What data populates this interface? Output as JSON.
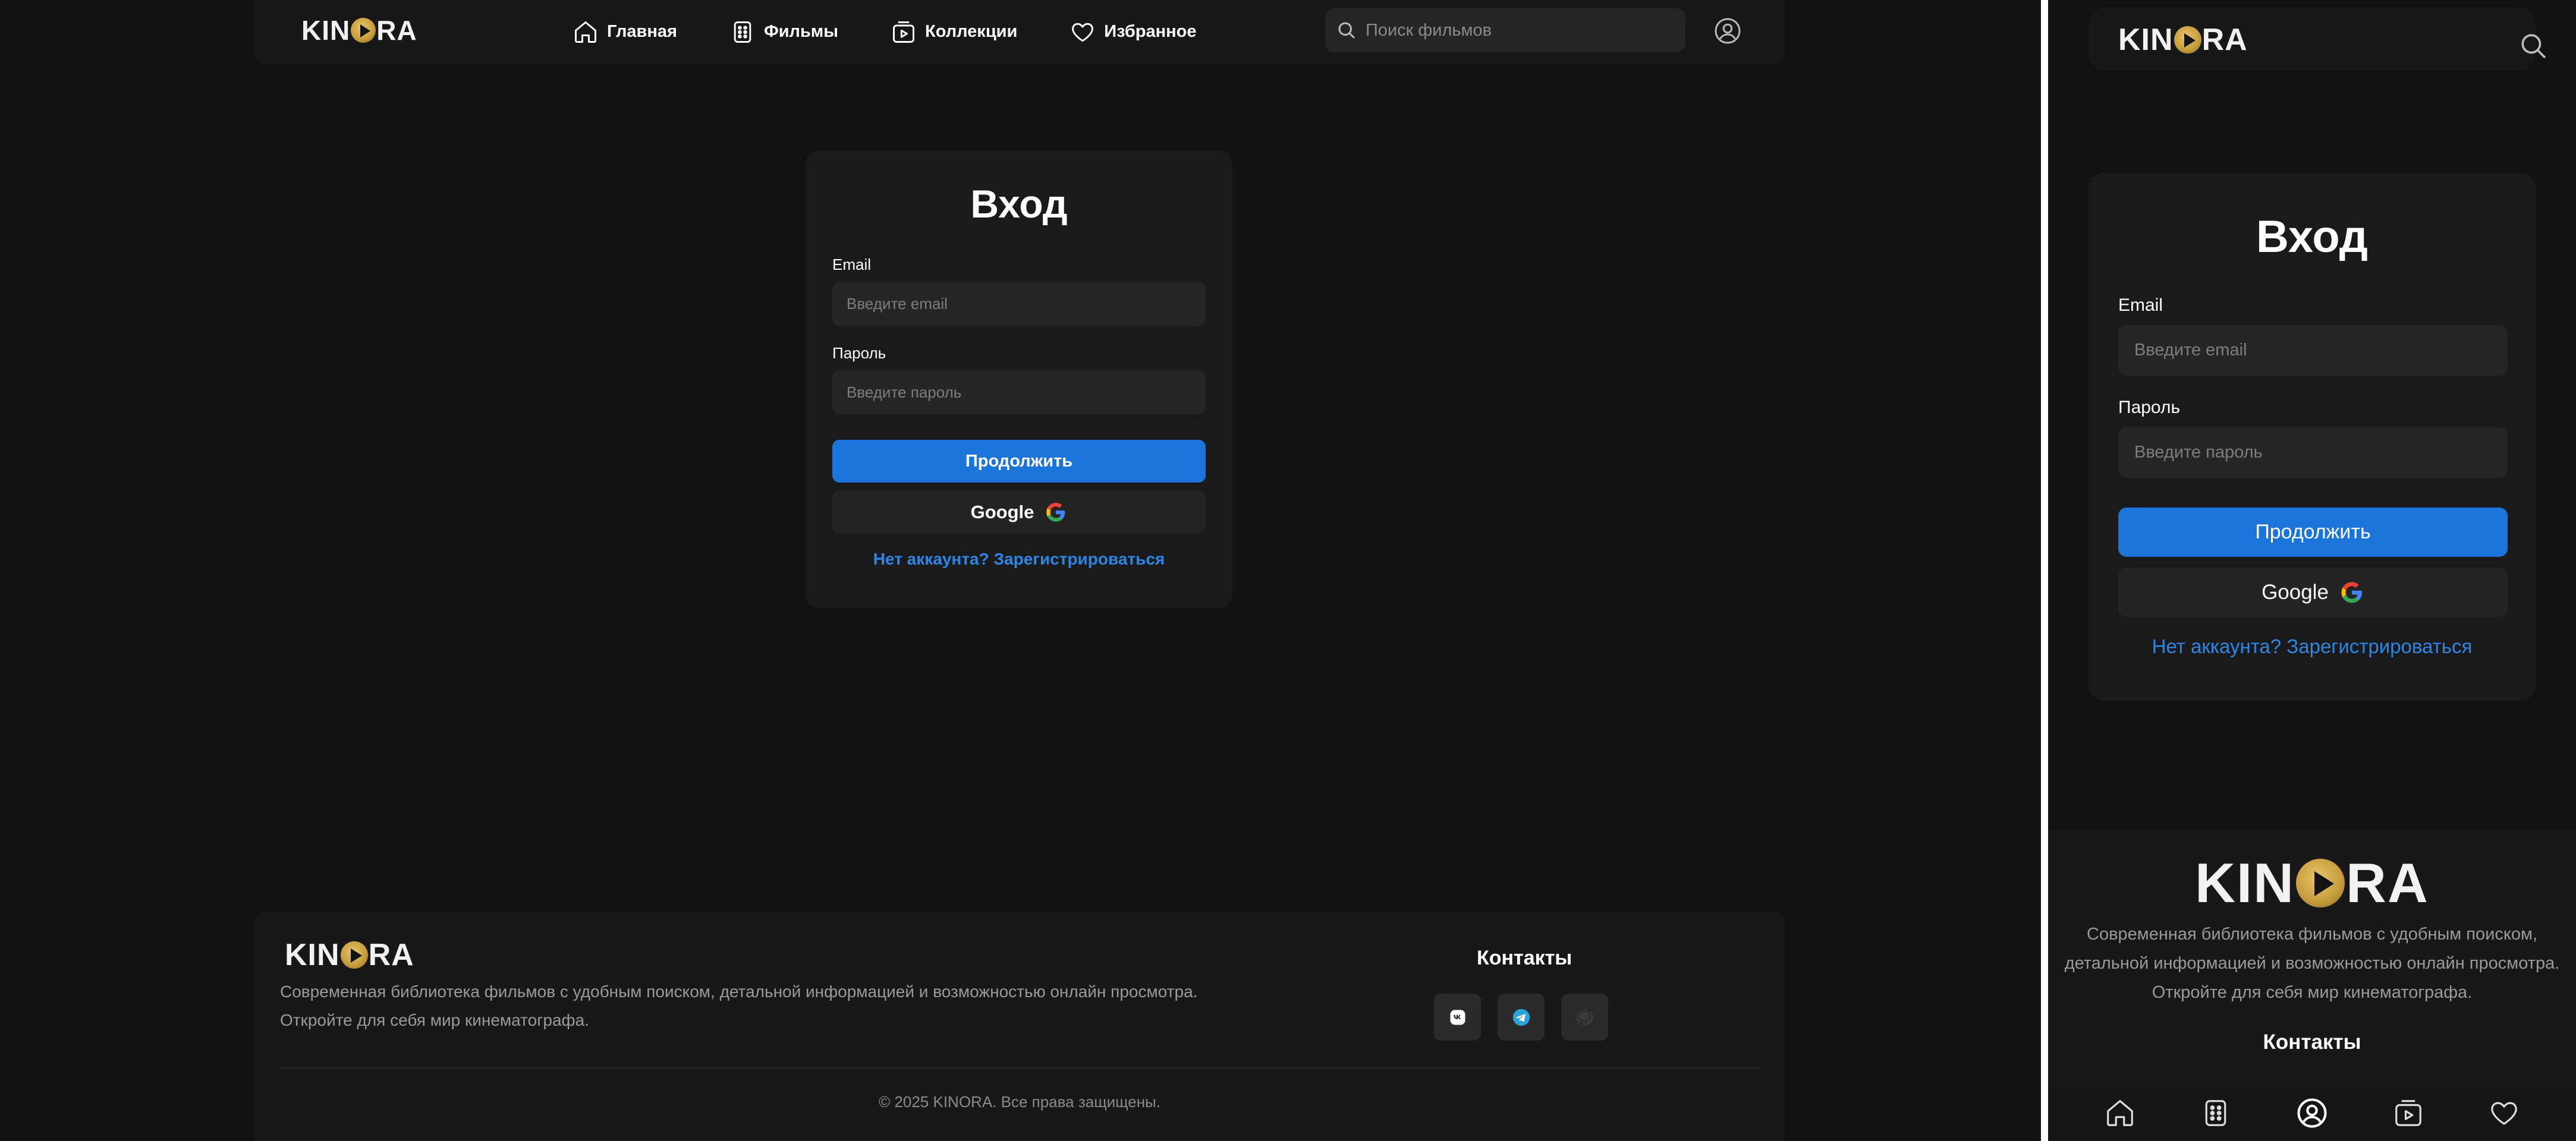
{
  "brand": {
    "pre": "KIN",
    "post": "RA"
  },
  "nav": {
    "items": [
      {
        "label": "Главная",
        "icon": "home-icon"
      },
      {
        "label": "Фильмы",
        "icon": "film-icon"
      },
      {
        "label": "Коллекции",
        "icon": "collection-icon"
      },
      {
        "label": "Избранное",
        "icon": "heart-icon"
      }
    ]
  },
  "search": {
    "placeholder": "Поиск фильмов"
  },
  "login": {
    "title": "Вход",
    "email_label": "Email",
    "email_placeholder": "Введите email",
    "password_label": "Пароль",
    "password_placeholder": "Введите пароль",
    "submit_label": "Продолжить",
    "google_label": "Google",
    "register_link": "Нет аккаунта? Зарегистрироваться"
  },
  "footer": {
    "description_line1": "Современная библиотека фильмов с удобным поиском, детальной информацией и возможностью онлайн просмотра.",
    "description_line2": "Откройте для себя мир кинематографа.",
    "mobile_description": "Современная библиотека фильмов с удобным поиском, детальной информацией и возможностью онлайн просмотра. Откройте для себя мир кинематографа.",
    "contacts_title": "Контакты",
    "socials": [
      "vk-icon",
      "telegram-icon",
      "github-icon"
    ],
    "copyright": "© 2025 KINORA. Все права защищены."
  },
  "mobile_nav": [
    "home-icon",
    "film-icon",
    "user-icon",
    "collection-icon",
    "heart-icon"
  ],
  "colors": {
    "accent": "#1b74d9",
    "link": "#2b86e6",
    "background": "#121212",
    "surface": "#1a1a1a",
    "gold": "#c9a040"
  }
}
